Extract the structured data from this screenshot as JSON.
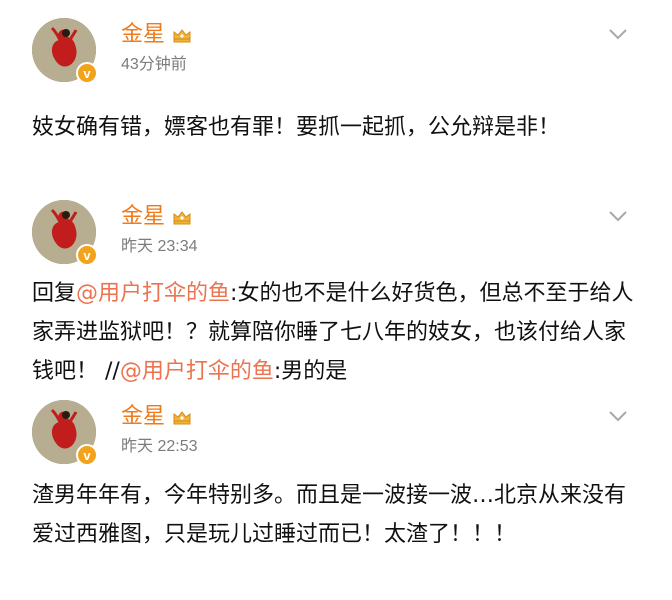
{
  "posts": [
    {
      "username": "金星",
      "timestamp": "43分钟前",
      "text": "妓女确有错，嫖客也有罪！要抓一起抓，公允辩是非！"
    },
    {
      "username": "金星",
      "timestamp": "昨天 23:34",
      "reply_prefix": "回复",
      "mention": "@用户打伞的鱼",
      "text_after_mention": ":女的也不是什么好货色，但总不至于给人家弄进监狱吧！？就算陪你睡了七八年的妓女，也该付给人家钱吧！",
      "slashes": "//",
      "repost_mention": "@用户打伞的鱼",
      "repost_text": ":男的是"
    },
    {
      "username": "金星",
      "timestamp": "昨天 22:53",
      "text": "渣男年年有，今年特别多。而且是一波接一波…北京从来没有爱过西雅图，只是玩儿过睡过而已！太渣了！！！"
    }
  ],
  "icons": {
    "crown": "crown-icon",
    "verified": "verified-badge-icon",
    "more": "chevron-down-icon"
  },
  "colors": {
    "username": "#f07a1a",
    "mention": "#eb7350",
    "badge": "#f2a21b",
    "timestamp": "#7c7c7c"
  },
  "badge_letter": "v"
}
